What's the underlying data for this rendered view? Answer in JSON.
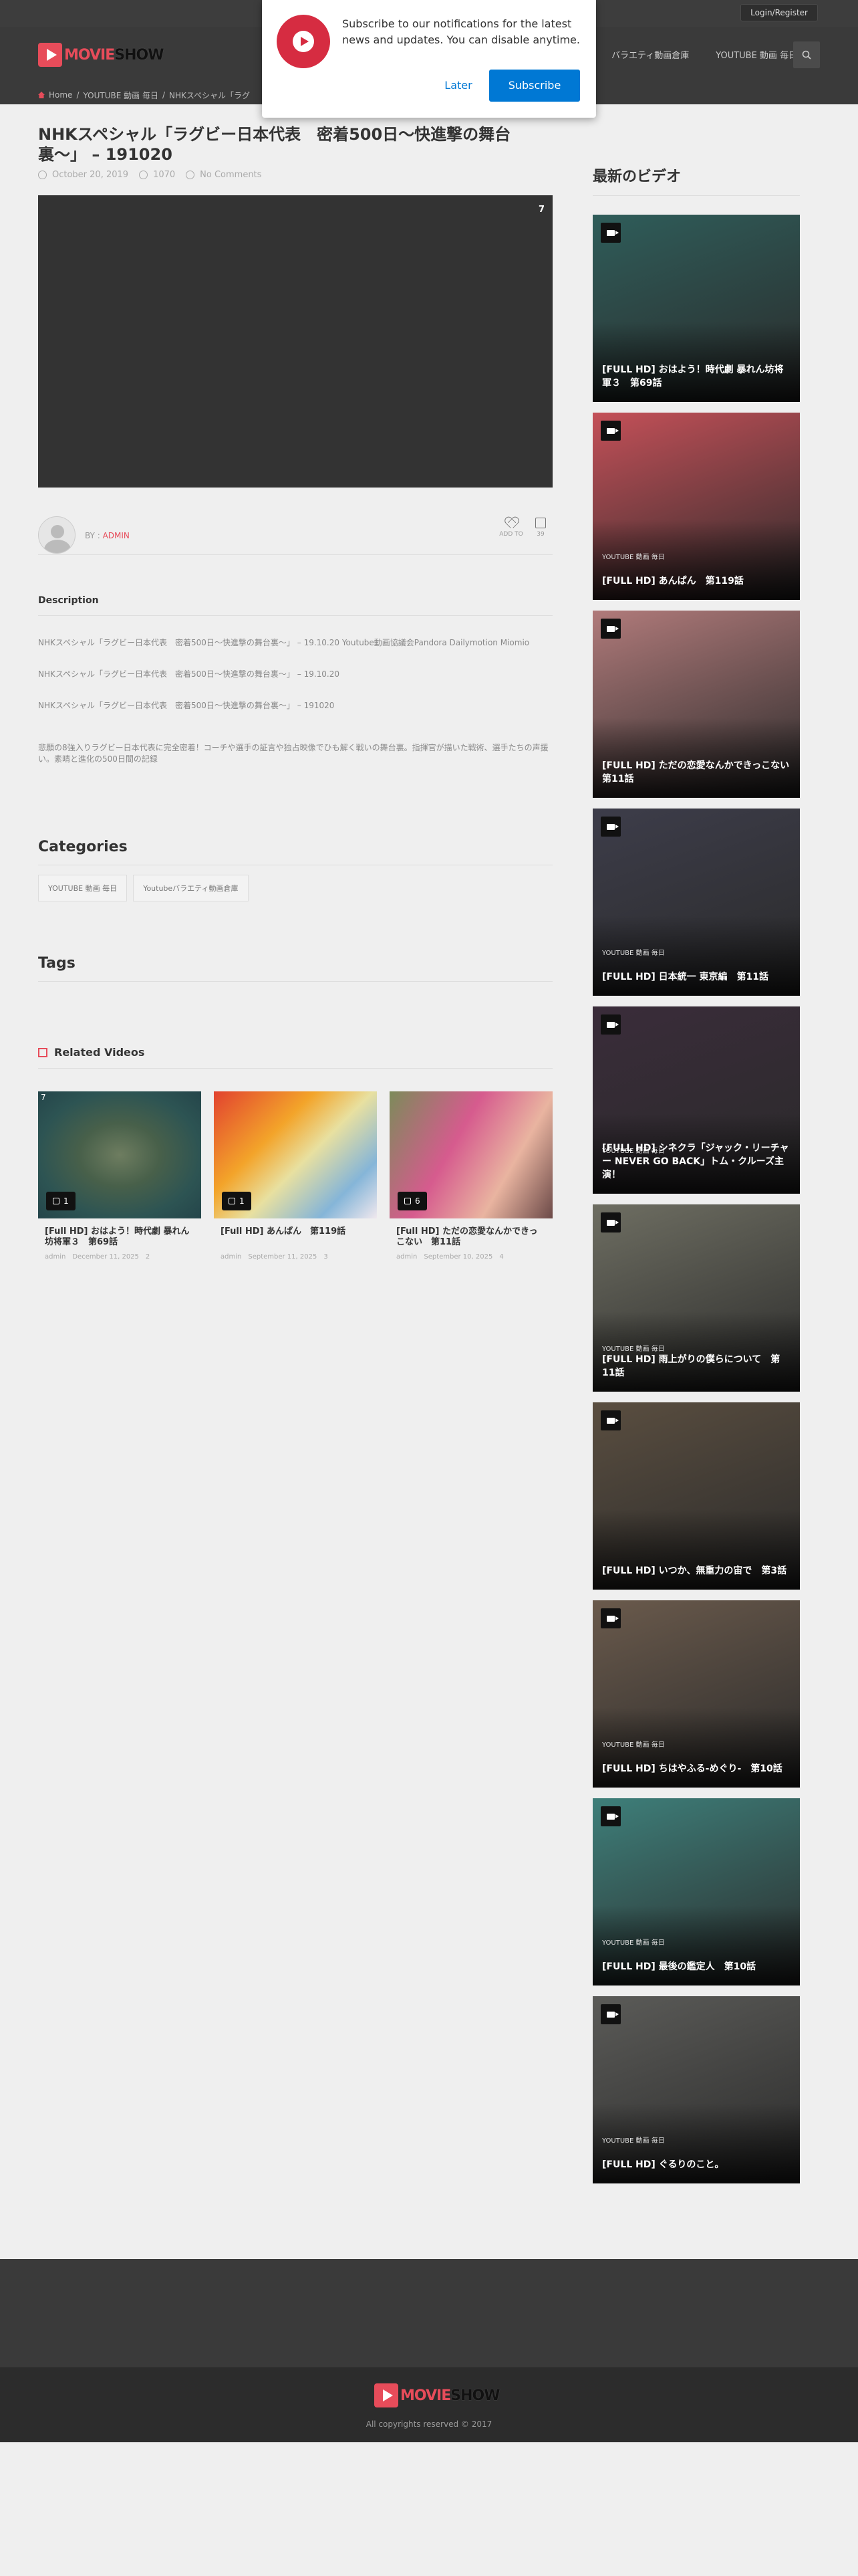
{
  "header": {
    "login_label": "Login/Register",
    "logo_movie": "MOVIE",
    "logo_show": "SHOW",
    "nav": [
      "バラエティ動画倉庫",
      "YOUTUBE 動画 毎日"
    ]
  },
  "breadcrumb": [
    "Home",
    "YOUTUBE 動画 毎日",
    "NHKスペシャル「ラグ"
  ],
  "popup": {
    "message": "Subscribe to our notifications for the latest news and updates. You can disable anytime.",
    "later": "Later",
    "subscribe": "Subscribe"
  },
  "post": {
    "title": "NHKスペシャル「ラグビー日本代表　密着500日〜快進撃の舞台裏〜」 – 191020",
    "date": "October 20, 2019",
    "views": "1070",
    "comments": "No Comments",
    "player_badge": "7",
    "by_label": "BY :",
    "author": "ADMIN",
    "add_to": "ADD TO",
    "likes": "39"
  },
  "description": {
    "heading": "Description",
    "paragraphs": [
      "NHKスペシャル「ラグビー日本代表　密着500日〜快進撃の舞台裏〜」 – 19.10.20 Youtube動画協議会Pandora Dailymotion Miomio",
      "NHKスペシャル「ラグビー日本代表　密着500日〜快進撃の舞台裏〜」 – 19.10.20",
      "NHKスペシャル「ラグビー日本代表　密着500日〜快進撃の舞台裏〜」 – 191020",
      "悲願の8強入りラグビー日本代表に完全密着！コーチや選手の証言や独占映像でひも解く戦いの舞台裏。指揮官が描いた戦術、選手たちの声援い。素晴と進化の500日間の記録"
    ]
  },
  "categories": {
    "heading": "Categories",
    "items": [
      "YOUTUBE 動画 毎日",
      "Youtubeバラエティ動画倉庫"
    ]
  },
  "tags": {
    "heading": "Tags"
  },
  "related": {
    "heading": "Related Videos",
    "items": [
      {
        "corner": "7",
        "likes": "1",
        "title": "[Full HD] おはよう！時代劇 暴れん坊将軍３　第69話",
        "author": "admin",
        "date": "December 11, 2025",
        "views": "2"
      },
      {
        "corner": "",
        "likes": "1",
        "title": "[Full HD] あんぱん　第119話",
        "author": "admin",
        "date": "September 11, 2025",
        "views": "3"
      },
      {
        "corner": "",
        "likes": "6",
        "title": "[Full HD] ただの恋愛なんかできっこない　第11話",
        "author": "admin",
        "date": "September 10, 2025",
        "views": "4"
      }
    ]
  },
  "sidebar": {
    "heading": "最新のビデオ",
    "items": [
      {
        "category": "",
        "title": "[FULL HD] おはよう！時代劇 暴れん坊将軍３　第69話",
        "color": "#2f5d5a"
      },
      {
        "category": "YOUTUBE 動画 毎日",
        "title": "[FULL HD] あんぱん　第119話",
        "color": "#c45058"
      },
      {
        "category": "",
        "title": "[FULL HD] ただの恋愛なんかできっこない　第11話",
        "color": "#b07a7a"
      },
      {
        "category": "YOUTUBE 動画 毎日",
        "title": "[FULL HD] 日本統一 東京編　第11話",
        "color": "#3d3d4a"
      },
      {
        "category": "YOUTUBE 動画 毎日",
        "title": "[FULL HD] シネクラ「ジャック・リーチャー NEVER GO BACK」トム・クルーズ主演！",
        "color": "#3a2c3a"
      },
      {
        "category": "YOUTUBE 動画 毎日",
        "title": "[FULL HD] 雨上がりの僕らについて　第11話",
        "color": "#6e6e62"
      },
      {
        "category": "",
        "title": "[FULL HD] いつか、無重力の宙で　第3話",
        "color": "#5a4e40"
      },
      {
        "category": "YOUTUBE 動画 毎日",
        "title": "[FULL HD] ちはやふる-めぐり-　第10話",
        "color": "#6a5a4c"
      },
      {
        "category": "YOUTUBE 動画 毎日",
        "title": "[FULL HD] 最後の鑑定人　第10話",
        "color": "#3e7f7a"
      },
      {
        "category": "YOUTUBE 動画 毎日",
        "title": "[FULL HD] ぐるりのこと。",
        "color": "#5b5b58"
      }
    ]
  },
  "footer": {
    "logo_movie": "MOVIE",
    "logo_show": "SHOW",
    "copyright": "All copyrights reserved © 2017"
  }
}
